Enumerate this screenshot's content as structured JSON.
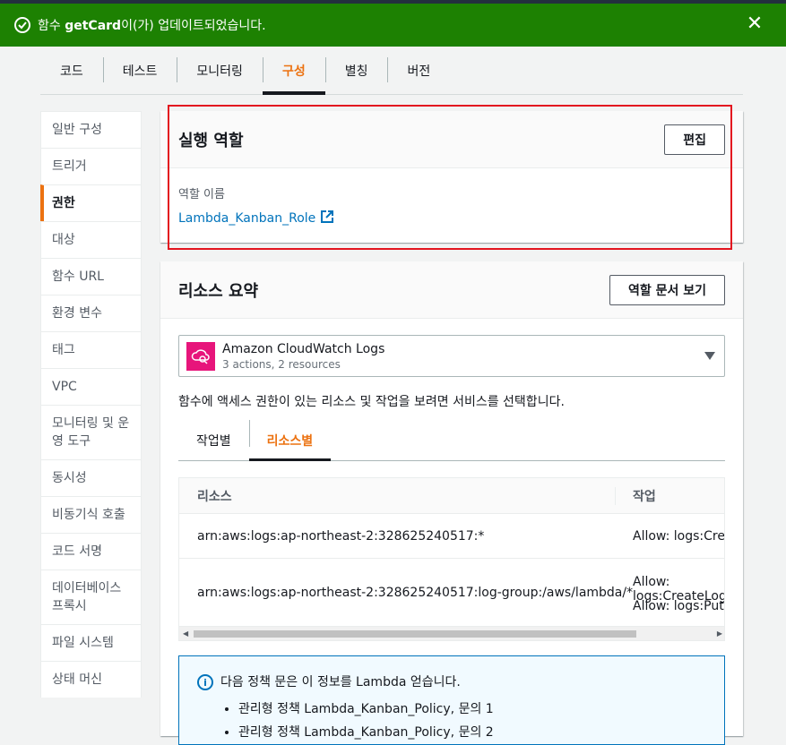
{
  "flash": {
    "prefix": "함수 ",
    "func_name": "getCard",
    "suffix": "이(가) 업데이트되었습니다.",
    "close_glyph": "✕"
  },
  "tabs": [
    "코드",
    "테스트",
    "모니터링",
    "구성",
    "별칭",
    "버전"
  ],
  "active_tab": "구성",
  "sidenav": [
    "일반 구성",
    "트리거",
    "권한",
    "대상",
    "함수 URL",
    "환경 변수",
    "태그",
    "VPC",
    "모니터링 및 운영 도구",
    "동시성",
    "비동기식 호출",
    "코드 서명",
    "데이터베이스 프록시",
    "파일 시스템",
    "상태 머신"
  ],
  "active_nav": "권한",
  "exec_role": {
    "title": "실행 역할",
    "edit_label": "편집",
    "role_label": "역할 이름",
    "role_name": "Lambda_Kanban_Role"
  },
  "resource_summary": {
    "title": "리소스 요약",
    "view_doc_label": "역할 문서 보기",
    "service": {
      "name": "Amazon CloudWatch Logs",
      "sub": "3 actions, 2 resources",
      "icon": "cloudwatch-logs-icon"
    },
    "hint": "함수에 액세스 권한이 있는 리소스 및 작업을 보려면 서비스를 선택합니다.",
    "subtabs": [
      "작업별",
      "리소스별"
    ],
    "active_subtab": "리소스별",
    "columns": [
      "리소스",
      "작업"
    ],
    "rows": [
      {
        "resource": "arn:aws:logs:ap-northeast-2:328625240517:*",
        "actions": [
          "Allow: logs:CreateLogGroup"
        ]
      },
      {
        "resource": "arn:aws:logs:ap-northeast-2:328625240517:log-group:/aws/lambda/*",
        "actions": [
          "Allow: logs:CreateLogStream",
          "Allow: logs:PutLogEvents"
        ]
      }
    ]
  },
  "info": {
    "text": "다음 정책 문은 이 정보를 Lambda 얻습니다.",
    "items": [
      "관리형 정책 Lambda_Kanban_Policy, 문의 1",
      "관리형 정책 Lambda_Kanban_Policy, 문의 2"
    ]
  },
  "colors": {
    "flash_bg": "#1d8102",
    "accent": "#ec7211",
    "link": "#0073bb",
    "highlight": "#e3141f"
  }
}
